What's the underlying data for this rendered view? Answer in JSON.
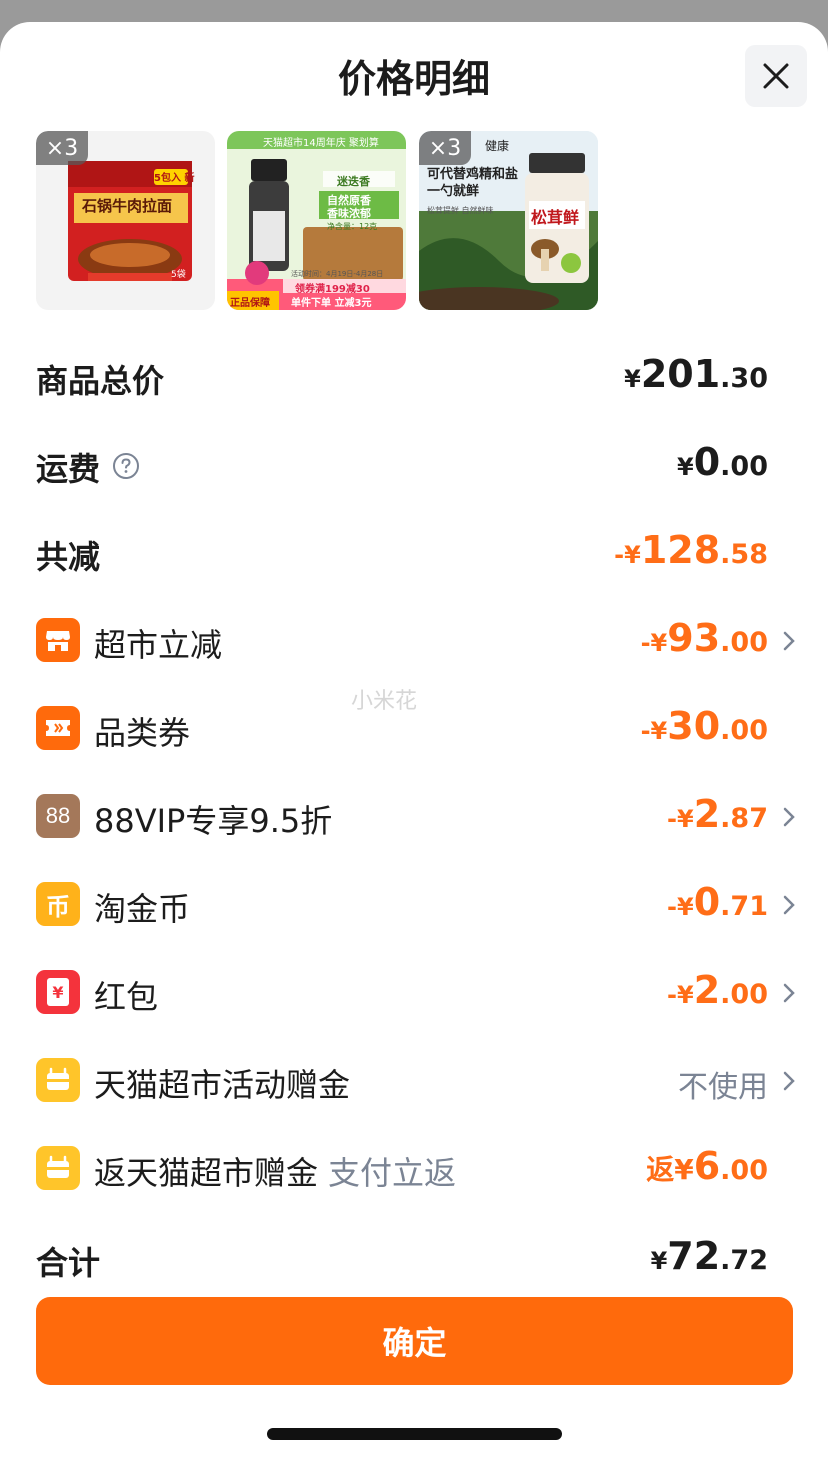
{
  "title": "价格明细",
  "products": [
    {
      "qty": "×3",
      "name": "石锅牛肉拉面",
      "badge": "5包入 新",
      "count": "5袋"
    },
    {
      "banner": "天猫超市14周年庆 聚划算",
      "name": "迷迭香",
      "line1": "自然原香",
      "line2": "香味浓郁",
      "net": "净含量：12克",
      "date": "活动时间：4月19日-4月28日",
      "coupon": "领券满199减30",
      "deal": "单件下单 立减3元",
      "guarantee": "正品保障"
    },
    {
      "qty": "×3",
      "brand": "健康",
      "line1": "可代替鸡精和盐",
      "line2": "一勺就鲜",
      "sub": "松茸提鲜 自然鲜味",
      "name": "松茸鲜"
    }
  ],
  "summary": {
    "goods_total": {
      "label": "商品总价",
      "currency": "¥",
      "int": "201",
      "dec": ".30"
    },
    "shipping": {
      "label": "运费",
      "currency": "¥",
      "int": "0",
      "dec": ".00"
    },
    "total_discount": {
      "label": "共减",
      "currency": "-¥",
      "int": "128",
      "dec": ".58"
    }
  },
  "discounts": [
    {
      "label": "超市立减",
      "currency": "-¥",
      "int": "93",
      "dec": ".00",
      "icon": "store-icon",
      "color": "#ff6a0c"
    },
    {
      "label": "品类券",
      "currency": "-¥",
      "int": "30",
      "dec": ".00",
      "icon": "ticket-icon",
      "color": "#ff6a0c"
    },
    {
      "label": "88VIP专享9.5折",
      "currency": "-¥",
      "int": "2",
      "dec": ".87",
      "icon": "vip-88-icon",
      "icon_text": "88",
      "color": "#a4785a"
    },
    {
      "label": "淘金币",
      "currency": "-¥",
      "int": "0",
      "dec": ".71",
      "icon": "gold-coin-icon",
      "icon_text": "币",
      "color": "#ffb21a"
    },
    {
      "label": "红包",
      "currency": "-¥",
      "int": "2",
      "dec": ".00",
      "icon": "red-packet-icon",
      "icon_text": "¥",
      "color": "#f4333c"
    },
    {
      "label": "天猫超市活动赠金",
      "value": "不使用",
      "icon": "gift-bag-icon",
      "color": "#ffc52a"
    },
    {
      "label": "返天猫超市赠金",
      "tag": "支付立返",
      "currency": "返¥",
      "int": "6",
      "dec": ".00",
      "icon": "gift-bag-icon",
      "color": "#ffc52a"
    }
  ],
  "total": {
    "label": "合计",
    "currency": "¥",
    "int": "72",
    "dec": ".72"
  },
  "confirm_label": "确定",
  "watermark": "小米花",
  "colors": {
    "accent": "#ff6a0c",
    "discount_text": "#ff6d17",
    "muted": "#7b8494"
  }
}
